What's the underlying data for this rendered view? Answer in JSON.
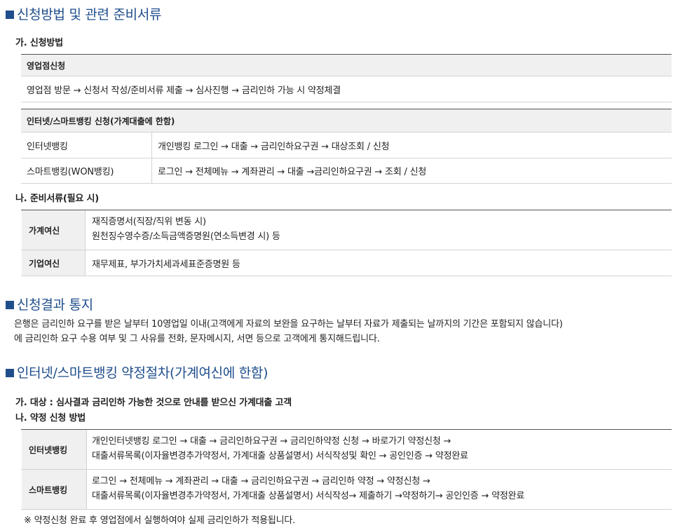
{
  "section1": {
    "title": "신청방법 및 관련 준비서류",
    "sub_a": "가. 신청방법",
    "branch": {
      "header": "영업점신청",
      "steps": "영업점 방문 → 신청서 작성/준비서류 제출 → 심사진행 → 금리인하 가능 시 약정체결"
    },
    "online": {
      "header": "인터넷/스마트뱅킹 신청(가계대출에 한함)",
      "rows": [
        {
          "label": "인터넷뱅킹",
          "steps": "개인뱅킹 로그인 → 대출 → 금리인하요구권 → 대상조회 / 신청"
        },
        {
          "label": "스마트뱅킹(WON뱅킹)",
          "steps": "로그인 → 전체메뉴 → 계좌관리 → 대출 →금리인하요구권 → 조회 / 신청"
        }
      ]
    },
    "sub_b": "나. 준비서류(필요 시)",
    "docs": [
      {
        "label": "가계여신",
        "line1": "재직증명서(직장/직위 변동 시)",
        "line2": "원천징수영수증/소득금액증명원(연소득변경 시) 등"
      },
      {
        "label": "기업여신",
        "line1": "재무제표, 부가가치세과세표준증명원 등"
      }
    ]
  },
  "section2": {
    "title": "신청결과 통지",
    "line1": "은행은 금리인하 요구를 받은 날부터 10영업일 이내(고객에게 자료의 보완을 요구하는 날부터 자료가 제출되는 날까지의 기간은 포함되지 않습니다)",
    "line2": "에 금리인하 요구 수용 여부 및 그 사유를 전화, 문자메시지, 서면 등으로 고객에게 통지해드립니다."
  },
  "section3": {
    "title": "인터넷/스마트뱅킹 약정절차(가계여신에 한함)",
    "sub_a": "가. 대상 : 심사결과 금리인하 가능한 것으로 안내를 받으신 가계대출 고객",
    "sub_b": "나. 약정 신청 방법",
    "rows": [
      {
        "label": "인터넷뱅킹",
        "line1": "개인인터넷뱅킹 로그인 → 대출 → 금리인하요구권 → 금리인하약정 신청 → 바로가기 약정신청 →",
        "line2": "대출서류목록(이자율변경추가약정서, 가계대출 상품설명서) 서식작성및 확인 → 공인인증 → 약정완료"
      },
      {
        "label": "스마트뱅킹",
        "line1": "로그인 → 전체메뉴 → 계좌관리 → 대출 → 금리인하요구권 → 금리인하 약정 → 약정신청 →",
        "line2": "대출서류목록(이자율변경추가약정서, 가계대출 상품설명서) 서식작성→ 제출하기 →약정하기→ 공인인증 → 약정완료"
      }
    ],
    "note": "※ 약정신청 완료 후 영업점에서 실행하여야 실제 금리인하가 적용됩니다."
  }
}
